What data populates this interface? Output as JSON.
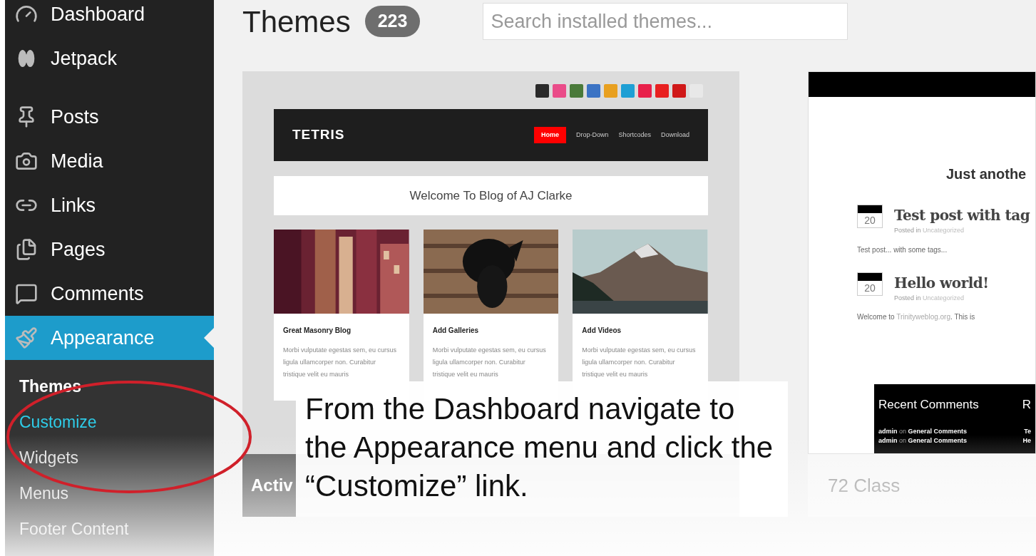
{
  "sidebar": {
    "items": [
      {
        "label": "Dashboard",
        "selected": false
      },
      {
        "label": "Jetpack",
        "selected": false
      },
      {
        "label": "Posts",
        "selected": false
      },
      {
        "label": "Media",
        "selected": false
      },
      {
        "label": "Links",
        "selected": false
      },
      {
        "label": "Pages",
        "selected": false
      },
      {
        "label": "Comments",
        "selected": false
      },
      {
        "label": "Appearance",
        "selected": true
      }
    ],
    "submenu": [
      {
        "label": "Themes",
        "selected": true,
        "hovered": false
      },
      {
        "label": "Customize",
        "selected": false,
        "hovered": true
      },
      {
        "label": "Widgets",
        "selected": false,
        "hovered": false
      },
      {
        "label": "Menus",
        "selected": false,
        "hovered": false
      },
      {
        "label": "Footer Content",
        "selected": false,
        "hovered": false
      }
    ]
  },
  "header": {
    "title": "Themes",
    "count": "223",
    "search": {
      "placeholder": "Search installed themes..."
    }
  },
  "themes": [
    {
      "kind": "tetris",
      "site_title": "TETRIS",
      "nav": [
        {
          "label": "Home",
          "selected": true
        },
        {
          "label": "Drop-Down",
          "selected": false
        },
        {
          "label": "Shortcodes",
          "selected": false
        },
        {
          "label": "Download",
          "selected": false
        }
      ],
      "welcome": "Welcome To Blog of AJ Clarke",
      "posts": [
        {
          "title": "Great Masonry Blog",
          "excerpt": "Morbi vulputate egestas sem, eu cursus ligula ullamcorper non. Curabitur tristique velit eu mauris"
        },
        {
          "title": "Add Galleries",
          "excerpt": "Morbi vulputate egestas sem, eu cursus ligula ullamcorper non. Curabitur tristique velit eu mauris"
        },
        {
          "title": "Add Videos",
          "excerpt": "Morbi vulputate egestas sem, eu cursus ligula ullamcorper non. Curabitur tristique velit eu mauris"
        }
      ],
      "footer_label": "Activ"
    },
    {
      "kind": "blog",
      "tagline": "Just anothe",
      "posts": [
        {
          "day": "20",
          "title": "Test post with tag",
          "meta": "Posted in",
          "category": "Uncategorized",
          "excerpt": "Test post... with some tags..."
        },
        {
          "day": "20",
          "title": "Hello world!",
          "meta": "Posted in",
          "category": "Uncategorized",
          "excerpt": "Welcome to",
          "link": "Trinityweblog.org",
          "excerpt_end": ". This is"
        }
      ],
      "widget": {
        "title": "Recent Comments",
        "column_2": "R",
        "comments": [
          {
            "author": "admin",
            "on": "on",
            "post": "General Comments",
            "column_2": "Te"
          },
          {
            "author": "admin",
            "on": "on",
            "post": "General Comments",
            "column_2": "He"
          }
        ]
      },
      "footer_label": "72 Class"
    }
  ],
  "caption": "From the Dashboard navigate to the Appearance menu and click the “Customize” link."
}
